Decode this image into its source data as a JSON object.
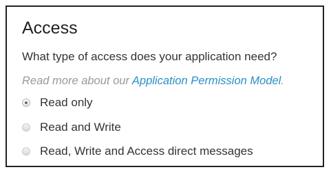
{
  "access": {
    "title": "Access",
    "question": "What type of access does your application need?",
    "read_more_prefix": "Read more about our ",
    "read_more_link": "Application Permission Model",
    "read_more_suffix": ".",
    "options": [
      {
        "label": "Read only",
        "selected": true
      },
      {
        "label": "Read and Write",
        "selected": false
      },
      {
        "label": "Read, Write and Access direct messages",
        "selected": false
      }
    ]
  }
}
